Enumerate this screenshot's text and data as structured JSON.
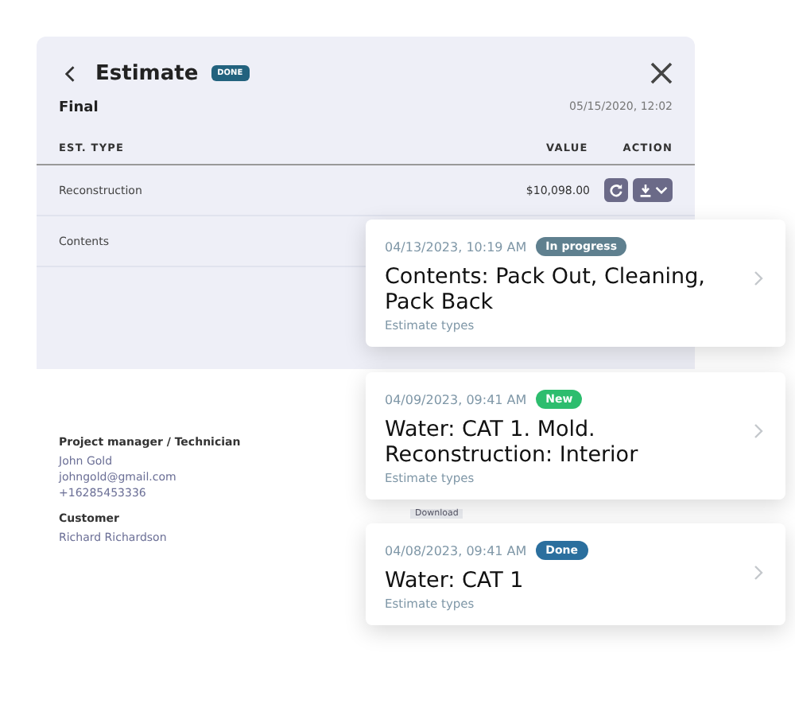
{
  "header": {
    "title": "Estimate",
    "badge": "DONE"
  },
  "subheader": {
    "label": "Final",
    "date": "05/15/2020, 12:02"
  },
  "table": {
    "columns": [
      "EST. TYPE",
      "VALUE",
      "ACTION"
    ],
    "rows": [
      {
        "type": "Reconstruction",
        "value": "$10,098.00",
        "actions": true
      },
      {
        "type": "Contents"
      }
    ]
  },
  "contacts": [
    {
      "heading": "Project manager / Technician",
      "lines": [
        "John Gold",
        "johngold@gmail.com",
        "+16285453336"
      ]
    },
    {
      "heading": "Customer",
      "lines": [
        "Richard Richardson"
      ]
    }
  ],
  "download": "Download",
  "cards": [
    {
      "date": "04/13/2023, 10:19 AM",
      "status": "In progress",
      "color": "#5f808f",
      "title": "Contents: Pack Out, Cleaning, Pack Back",
      "subtitle": "Estimate types"
    },
    {
      "date": "04/09/2023, 09:41 AM",
      "status": "New",
      "color": "#2dbd6e",
      "title": "Water: CAT 1. Mold. Reconstruction: Interior",
      "subtitle": "Estimate types"
    },
    {
      "date": "04/08/2023, 09:41 AM",
      "status": "Done",
      "color": "#2b6f9e",
      "title": "Water: CAT 1",
      "subtitle": "Estimate types"
    }
  ]
}
